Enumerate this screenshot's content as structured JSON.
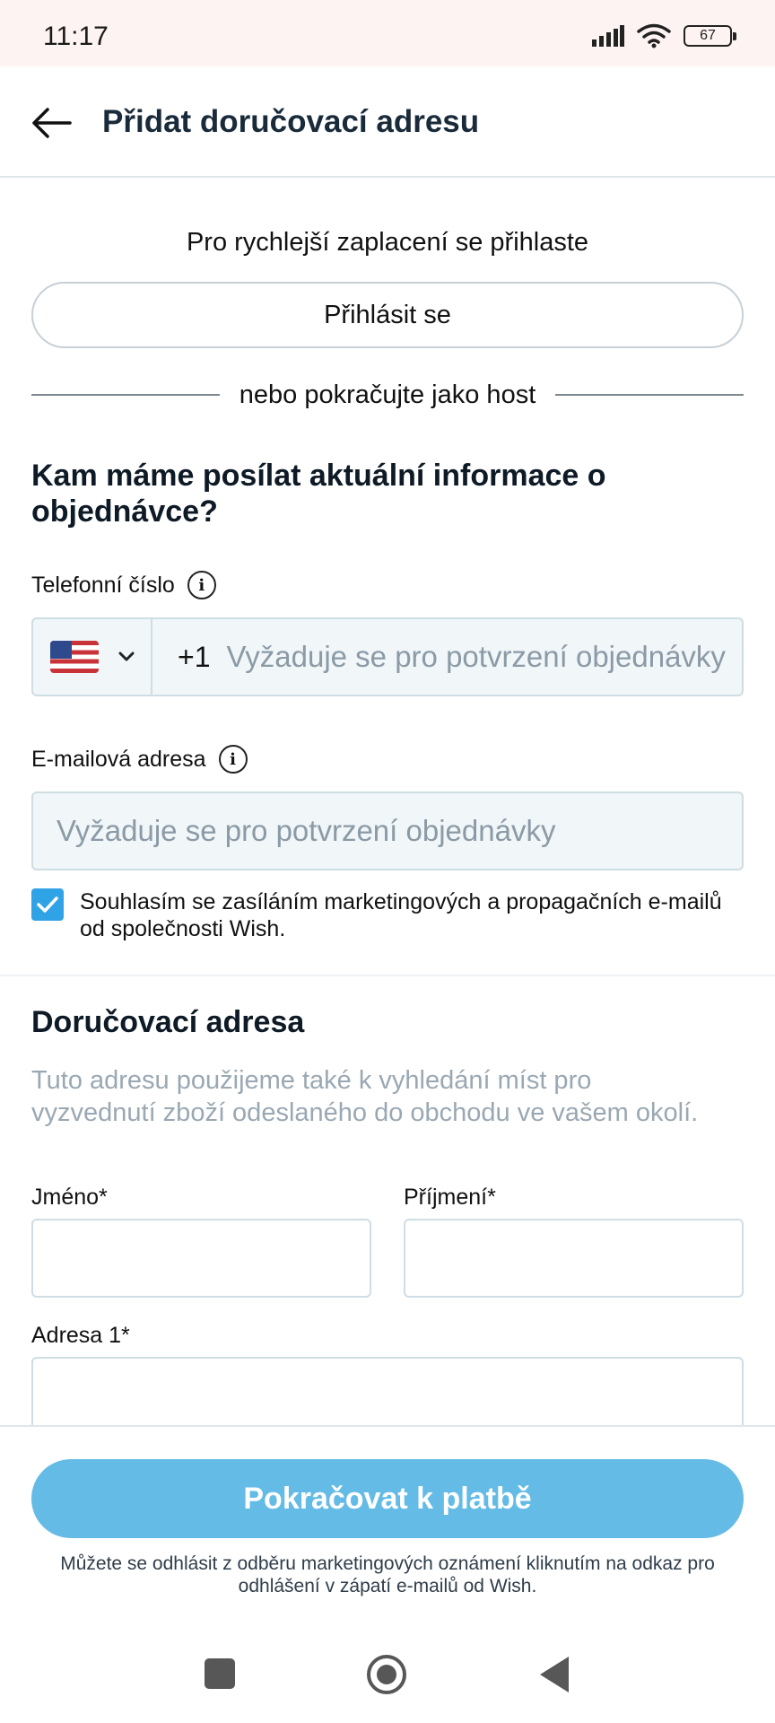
{
  "status_bar": {
    "time": "11:17",
    "battery": "67",
    "icons": [
      "signal-icon",
      "wifi-icon",
      "battery-icon"
    ]
  },
  "header": {
    "back_icon": "arrow-left-icon",
    "title": "Přidat doručovací adresu"
  },
  "login": {
    "prompt": "Pro rychlejší zaplacení se přihlaste",
    "button_label": "Přihlásit se",
    "divider_text": "nebo pokračujte jako host"
  },
  "contact": {
    "heading": "Kam máme posílat aktuální informace o objednávce?",
    "phone": {
      "label": "Telefonní číslo",
      "country_flag": "us-flag-icon",
      "prefix": "+1",
      "placeholder": "Vyžaduje se pro potvrzení objednávky",
      "value": ""
    },
    "email": {
      "label": "E-mailová adresa",
      "placeholder": "Vyžaduje se pro potvrzení objednávky",
      "value": ""
    },
    "consent": {
      "checked": true,
      "text": "Souhlasím se zasíláním marketingových a propagačních e-mailů od společnosti Wish."
    }
  },
  "delivery": {
    "heading": "Doručovací adresa",
    "description": "Tuto adresu použijeme také k vyhledání míst pro vyzvednutí zboží odeslaného do obchodu ve vašem okolí.",
    "first_name_label": "Jméno*",
    "last_name_label": "Příjmení*",
    "address1_label": "Adresa 1*"
  },
  "footer": {
    "pay_button": "Pokračovat k platbě",
    "note": "Můžete se odhlásit z odběru marketingových oznámení kliknutím na odkaz pro odhlášení v zápatí e-mailů od Wish."
  },
  "colors": {
    "accent": "#2fa3e6",
    "pay_button": "#64bbe6",
    "heading": "#0e1a26",
    "muted_text": "#9aa8b3",
    "status_bar_bg": "#fdf3f2"
  }
}
